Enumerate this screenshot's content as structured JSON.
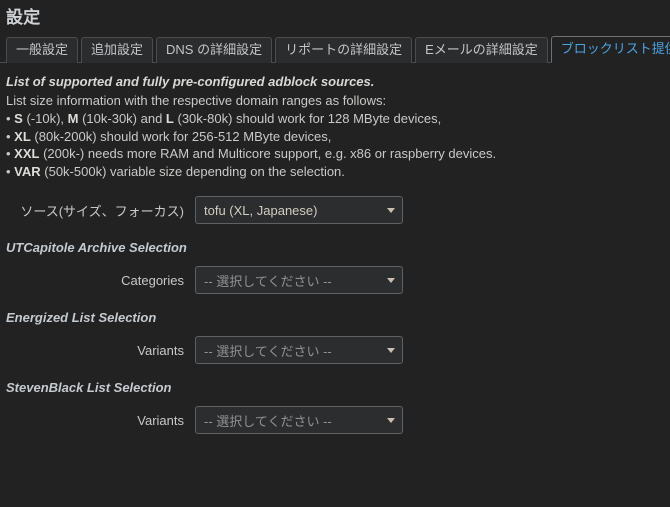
{
  "page": {
    "title": "設定"
  },
  "tabs": [
    {
      "label": "一般設定",
      "active": false
    },
    {
      "label": "追加設定",
      "active": false
    },
    {
      "label": "DNS の詳細設定",
      "active": false
    },
    {
      "label": "リポートの詳細設定",
      "active": false
    },
    {
      "label": "Eメールの詳細設定",
      "active": false
    },
    {
      "label": "ブロックリスト提供元",
      "active": true
    }
  ],
  "description": {
    "lead": "List of supported and fully pre-configured adblock sources.",
    "sub": "List size information with the respective domain ranges as follows:",
    "bullets": [
      {
        "prefix": "• ",
        "strong1": "S",
        "mid1": " (-10k), ",
        "strong2": "M",
        "mid2": " (10k-30k) and ",
        "strong3": "L",
        "rest": " (30k-80k) should work for 128 MByte devices,"
      },
      {
        "prefix": "• ",
        "strong1": "XL",
        "mid1": "",
        "strong2": "",
        "mid2": "",
        "strong3": "",
        "rest": " (80k-200k) should work for 256-512 MByte devices,"
      },
      {
        "prefix": "• ",
        "strong1": "XXL",
        "mid1": "",
        "strong2": "",
        "mid2": "",
        "strong3": "",
        "rest": " (200k-) needs more RAM and Multicore support, e.g. x86 or raspberry devices."
      },
      {
        "prefix": "• ",
        "strong1": "VAR",
        "mid1": "",
        "strong2": "",
        "mid2": "",
        "strong3": "",
        "rest": " (50k-500k) variable size depending on the selection."
      }
    ]
  },
  "form": {
    "source_row": {
      "label": "ソース(サイズ、フォーカス)",
      "value": "tofu (XL, Japanese)"
    },
    "sections": [
      {
        "heading": "UTCapitole Archive Selection",
        "row_label": "Categories",
        "row_value": "-- 選択してください --"
      },
      {
        "heading": "Energized List Selection",
        "row_label": "Variants",
        "row_value": "-- 選択してください --"
      },
      {
        "heading": "StevenBlack List Selection",
        "row_label": "Variants",
        "row_value": "-- 選択してください --"
      }
    ]
  },
  "icons": {
    "dropdown_arrow": "chevron-down-icon"
  },
  "colors": {
    "background": "#222223",
    "text": "#c8c8c8",
    "active_tab_text": "#4da3e0",
    "tab_bg": "#2b2c2d",
    "border": "#4a4c4e",
    "select_bg": "#2c2d2e",
    "select_border": "#5f6265",
    "placeholder_text": "#8e9295",
    "section_heading": "#c5cace"
  }
}
